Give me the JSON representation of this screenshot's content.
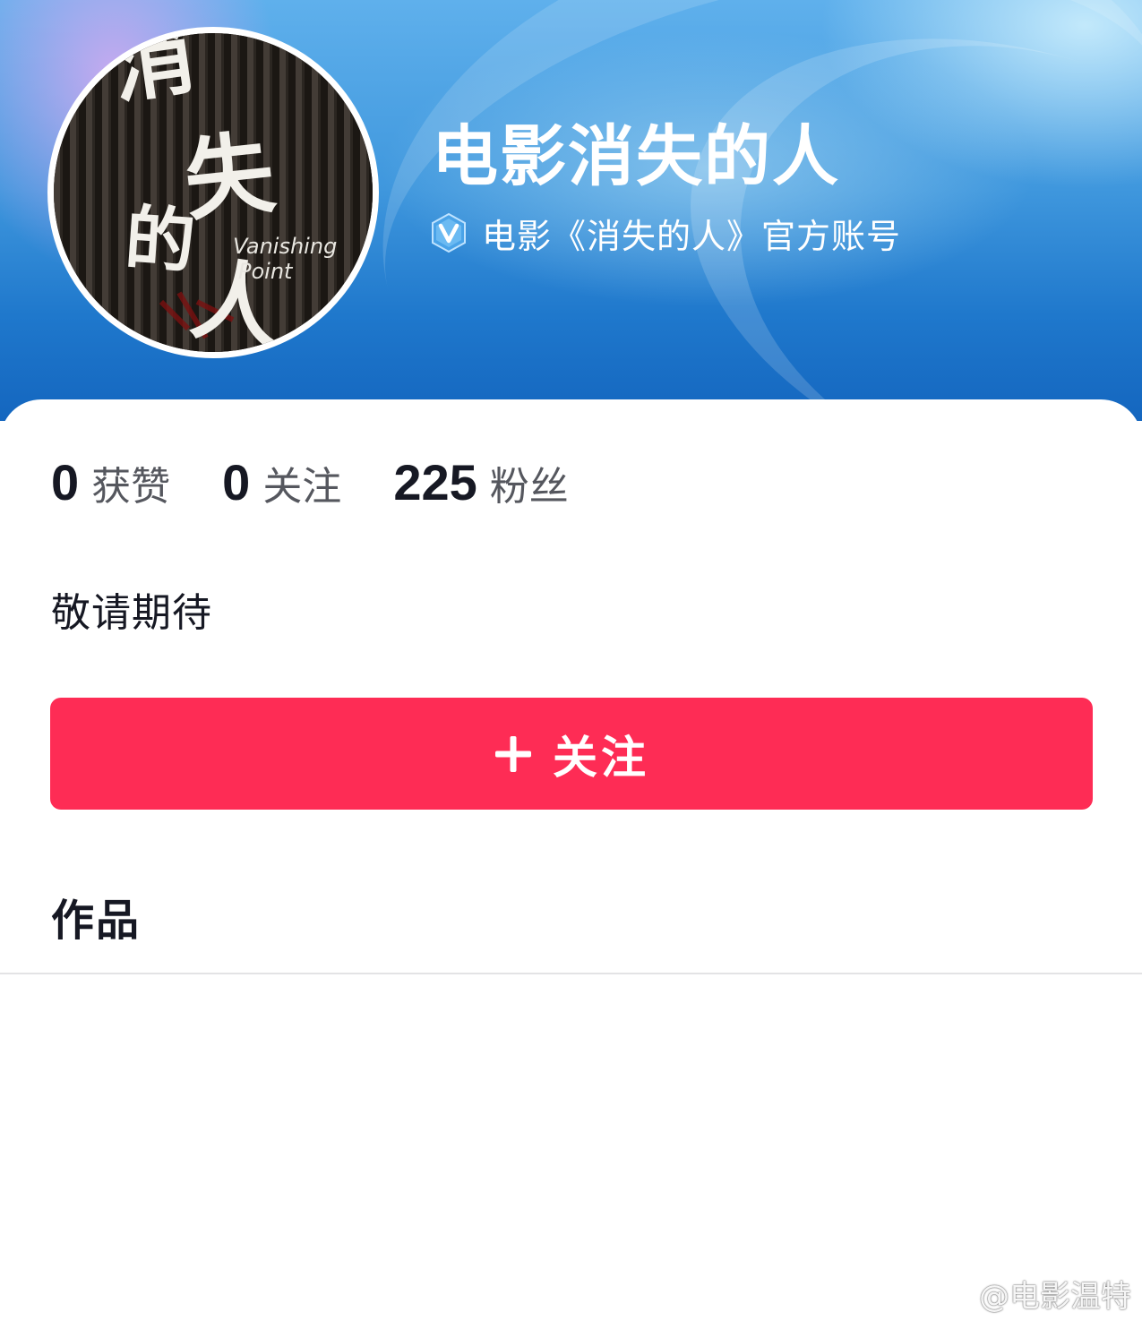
{
  "profile": {
    "name": "电影消失的人",
    "verification": "电影《消失的人》官方账号",
    "bio": "敬请期待",
    "avatar_text": [
      "消",
      "失",
      "的",
      "人",
      "Vanishing",
      "Point"
    ]
  },
  "stats": [
    {
      "value": "0",
      "label": "获赞"
    },
    {
      "value": "0",
      "label": "关注"
    },
    {
      "value": "225",
      "label": "粉丝"
    }
  ],
  "follow_button": {
    "label": "关注"
  },
  "works": {
    "title": "作品"
  },
  "watermark": {
    "text": "@电影温特"
  },
  "colors": {
    "follow_button": "#fe2c55",
    "text_primary": "#161823",
    "text_secondary": "#55575e",
    "verified_badge": "#4aa3e8"
  },
  "icons": {
    "verified": "verified-v-icon",
    "plus": "plus-icon",
    "weibo": "weibo-logo-icon"
  }
}
